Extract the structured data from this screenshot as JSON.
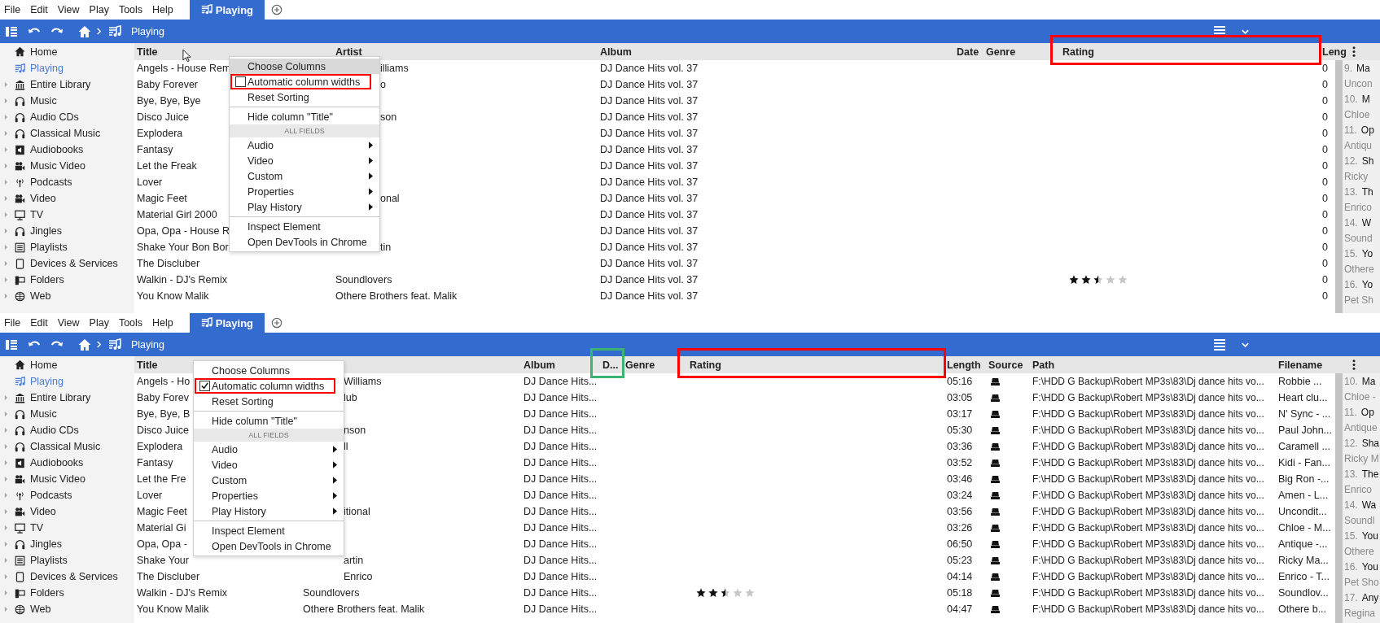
{
  "panels": [
    {
      "menu": [
        "File",
        "Edit",
        "View",
        "Play",
        "Tools",
        "Help"
      ],
      "tabs": [
        {
          "label": "Playing",
          "selected": true
        }
      ],
      "breadcrumb": "Playing",
      "mouse_cursor": true,
      "sidebar": [
        {
          "label": "Home",
          "selected": false,
          "expandable": false
        },
        {
          "label": "Playing",
          "selected": true,
          "expandable": false
        },
        {
          "label": "Entire Library",
          "selected": false,
          "expandable": true
        },
        {
          "label": "Music",
          "selected": false,
          "expandable": true
        },
        {
          "label": "Audio CDs",
          "selected": false,
          "expandable": true
        },
        {
          "label": "Classical Music",
          "selected": false,
          "expandable": true
        },
        {
          "label": "Audiobooks",
          "selected": false,
          "expandable": true
        },
        {
          "label": "Music Video",
          "selected": false,
          "expandable": true
        },
        {
          "label": "Podcasts",
          "selected": false,
          "expandable": true
        },
        {
          "label": "Video",
          "selected": false,
          "expandable": true
        },
        {
          "label": "TV",
          "selected": false,
          "expandable": true
        },
        {
          "label": "Jingles",
          "selected": false,
          "expandable": true
        },
        {
          "label": "Playlists",
          "selected": false,
          "expandable": true
        },
        {
          "label": "Devices & Services",
          "selected": false,
          "expandable": true
        },
        {
          "label": "Folders",
          "selected": false,
          "expandable": true
        },
        {
          "label": "Web",
          "selected": false,
          "expandable": true
        }
      ],
      "columns": [
        {
          "label": "Title",
          "kind": "title"
        },
        {
          "label": "Artist",
          "kind": "artist"
        },
        {
          "label": "Album",
          "kind": "album"
        },
        {
          "label": "Date",
          "kind": "date"
        },
        {
          "label": "Genre",
          "kind": "genre"
        },
        {
          "label": "Rating",
          "kind": "rating",
          "color": "#ff0000"
        },
        {
          "label": "Leng",
          "kind": "length"
        }
      ],
      "rows": [
        {
          "title": "Angels - House Rem",
          "artist": "illiams",
          "album": "DJ Dance Hits vol. 37",
          "length": "0"
        },
        {
          "title": "Baby Forever",
          "artist": "o",
          "album": "DJ Dance Hits vol. 37",
          "length": "0"
        },
        {
          "title": "Bye, Bye, Bye",
          "album": "DJ Dance Hits vol. 37",
          "length": "0"
        },
        {
          "title": "Disco Juice",
          "artist": "son",
          "album": "DJ Dance Hits vol. 37",
          "length": "0"
        },
        {
          "title": "Explodera",
          "album": "DJ Dance Hits vol. 37",
          "length": "0"
        },
        {
          "title": "Fantasy",
          "album": "DJ Dance Hits vol. 37",
          "length": "0"
        },
        {
          "title": "Let the Freak",
          "album": "DJ Dance Hits vol. 37",
          "length": "0"
        },
        {
          "title": "Lover",
          "album": "DJ Dance Hits vol. 37",
          "length": "0"
        },
        {
          "title": "Magic Feet",
          "artist": "onal",
          "album": "DJ Dance Hits vol. 37",
          "length": "0"
        },
        {
          "title": "Material Girl 2000",
          "album": "DJ Dance Hits vol. 37",
          "length": "0"
        },
        {
          "title": "Opa, Opa - House R",
          "album": "DJ Dance Hits vol. 37",
          "length": "0"
        },
        {
          "title": "Shake Your Bon Bor",
          "artist": "tin",
          "album": "DJ Dance Hits vol. 37",
          "length": "0"
        },
        {
          "title": "The Discluber",
          "album": "DJ Dance Hits vol. 37",
          "length": "0"
        },
        {
          "title": "Walkin - DJ's Remix",
          "artist": "Soundlovers",
          "album": "DJ Dance Hits vol. 37",
          "stars": 2.5,
          "length": "0"
        },
        {
          "title": "You Know Malik",
          "artist": "Othere Brothers feat. Malik",
          "album": "DJ Dance Hits vol. 37",
          "length": "0"
        }
      ],
      "context_menu": {
        "items": [
          {
            "kind": "item",
            "label": "Choose Columns",
            "selected": true
          },
          {
            "kind": "check",
            "label": "Automatic column widths",
            "checked": false,
            "selected": false,
            "color": "#ff0000"
          },
          {
            "kind": "item",
            "label": "Reset Sorting",
            "selected": false
          },
          {
            "kind": "separator"
          },
          {
            "kind": "item",
            "label": "Hide column \"Title\"",
            "selected": false
          },
          {
            "kind": "section",
            "label": "ALL FIELDS"
          },
          {
            "kind": "submenu",
            "label": "Audio",
            "selected": false
          },
          {
            "kind": "submenu",
            "label": "Video",
            "selected": false
          },
          {
            "kind": "submenu",
            "label": "Custom",
            "selected": false
          },
          {
            "kind": "submenu",
            "label": "Properties",
            "selected": false
          },
          {
            "kind": "submenu",
            "label": "Play History",
            "selected": false
          },
          {
            "kind": "separator"
          },
          {
            "kind": "item",
            "label": "Inspect Element",
            "selected": false
          },
          {
            "kind": "item",
            "label": "Open DevTools in Chrome",
            "selected": false
          }
        ]
      },
      "now_playing": [
        {
          "number": "9.",
          "title": "Ma",
          "artist": "Uncon"
        },
        {
          "number": "10.",
          "title": "M",
          "artist": "Chloe"
        },
        {
          "number": "11.",
          "title": "Op",
          "artist": "Antiqu"
        },
        {
          "number": "12.",
          "title": "Sh",
          "artist": "Ricky"
        },
        {
          "number": "13.",
          "title": "Th",
          "artist": "Enrico"
        },
        {
          "number": "14.",
          "title": "W",
          "artist": "Sound"
        },
        {
          "number": "15.",
          "title": "Yo",
          "artist": "Othere"
        },
        {
          "number": "16.",
          "title": "Yo",
          "artist": "Pet Sh"
        }
      ]
    },
    {
      "menu": [
        "File",
        "Edit",
        "View",
        "Play",
        "Tools",
        "Help"
      ],
      "tabs": [
        {
          "label": "Playing",
          "selected": true
        }
      ],
      "breadcrumb": "Playing",
      "sidebar": [
        {
          "label": "Home",
          "selected": false,
          "expandable": false
        },
        {
          "label": "Playing",
          "selected": true,
          "expandable": false
        },
        {
          "label": "Entire Library",
          "selected": false,
          "expandable": true
        },
        {
          "label": "Music",
          "selected": false,
          "expandable": true
        },
        {
          "label": "Audio CDs",
          "selected": false,
          "expandable": true
        },
        {
          "label": "Classical Music",
          "selected": false,
          "expandable": true
        },
        {
          "label": "Audiobooks",
          "selected": false,
          "expandable": true
        },
        {
          "label": "Music Video",
          "selected": false,
          "expandable": true
        },
        {
          "label": "Podcasts",
          "selected": false,
          "expandable": true
        },
        {
          "label": "Video",
          "selected": false,
          "expandable": true
        },
        {
          "label": "TV",
          "selected": false,
          "expandable": true
        },
        {
          "label": "Jingles",
          "selected": false,
          "expandable": true
        },
        {
          "label": "Playlists",
          "selected": false,
          "expandable": true
        },
        {
          "label": "Devices & Services",
          "selected": false,
          "expandable": true
        },
        {
          "label": "Folders",
          "selected": false,
          "expandable": true
        },
        {
          "label": "Web",
          "selected": false,
          "expandable": true
        }
      ],
      "columns": [
        {
          "label": "Title",
          "kind": "title"
        },
        {
          "kind": "artist"
        },
        {
          "label": "Album",
          "kind": "album"
        },
        {
          "label": "D...",
          "kind": "date",
          "color": "#3cb371"
        },
        {
          "label": "Genre",
          "kind": "genre"
        },
        {
          "label": "Rating",
          "kind": "rating",
          "color": "#ff0000"
        },
        {
          "label": "Length",
          "kind": "length"
        },
        {
          "label": "Source",
          "kind": "source"
        },
        {
          "label": "Path",
          "kind": "path"
        },
        {
          "label": "Filename",
          "kind": "filename"
        }
      ],
      "rows": [
        {
          "title": "Angels - Ho",
          "artist": "Williams",
          "album": "DJ Dance Hits...",
          "length": "05:16",
          "path": "F:\\HDD G Backup\\Robert MP3s\\83\\Dj dance hits vo...",
          "filename": "Robbie ..."
        },
        {
          "title": "Baby Forev",
          "artist": "lub",
          "album": "DJ Dance Hits...",
          "length": "03:05",
          "path": "F:\\HDD G Backup\\Robert MP3s\\83\\Dj dance hits vo...",
          "filename": "Heart clu..."
        },
        {
          "title": "Bye, Bye, B",
          "album": "DJ Dance Hits...",
          "length": "03:17",
          "path": "F:\\HDD G Backup\\Robert MP3s\\83\\Dj dance hits vo...",
          "filename": "N' Sync - ..."
        },
        {
          "title": "Disco Juice",
          "artist": "nson",
          "album": "DJ Dance Hits...",
          "length": "05:30",
          "path": "F:\\HDD G Backup\\Robert MP3s\\83\\Dj dance hits vo...",
          "filename": "Paul John..."
        },
        {
          "title": "Explodera",
          "artist": "ll",
          "album": "DJ Dance Hits...",
          "length": "03:36",
          "path": "F:\\HDD G Backup\\Robert MP3s\\83\\Dj dance hits vo...",
          "filename": "Caramell ..."
        },
        {
          "title": "Fantasy",
          "album": "DJ Dance Hits...",
          "length": "03:52",
          "path": "F:\\HDD G Backup\\Robert MP3s\\83\\Dj dance hits vo...",
          "filename": "Kidi - Fan..."
        },
        {
          "title": "Let the Fre",
          "album": "DJ Dance Hits...",
          "length": "03:46",
          "path": "F:\\HDD G Backup\\Robert MP3s\\83\\Dj dance hits vo...",
          "filename": "Big Ron -..."
        },
        {
          "title": "Lover",
          "album": "DJ Dance Hits...",
          "length": "03:24",
          "path": "F:\\HDD G Backup\\Robert MP3s\\83\\Dj dance hits vo...",
          "filename": "Amen - L..."
        },
        {
          "title": "Magic Feet",
          "artist": "itional",
          "album": "DJ Dance Hits...",
          "length": "03:56",
          "path": "F:\\HDD G Backup\\Robert MP3s\\83\\Dj dance hits vo...",
          "filename": "Uncondit..."
        },
        {
          "title": "Material Gi",
          "album": "DJ Dance Hits...",
          "length": "03:26",
          "path": "F:\\HDD G Backup\\Robert MP3s\\83\\Dj dance hits vo...",
          "filename": "Chloe - M..."
        },
        {
          "title": "Opa, Opa -",
          "album": "DJ Dance Hits...",
          "length": "06:50",
          "path": "F:\\HDD G Backup\\Robert MP3s\\83\\Dj dance hits vo...",
          "filename": "Antique -..."
        },
        {
          "title": "Shake Your",
          "artist": "artin",
          "album": "DJ Dance Hits...",
          "length": "05:23",
          "path": "F:\\HDD G Backup\\Robert MP3s\\83\\Dj dance hits vo...",
          "filename": "Ricky Ma..."
        },
        {
          "title": "The Discluber",
          "artist": "Enrico",
          "album": "DJ Dance Hits...",
          "length": "04:14",
          "path": "F:\\HDD G Backup\\Robert MP3s\\83\\Dj dance hits vo...",
          "filename": "Enrico - T..."
        },
        {
          "title": "Walkin - DJ's Remix",
          "artist": "Soundlovers",
          "album": "DJ Dance Hits...",
          "stars": 2.5,
          "length": "05:18",
          "path": "F:\\HDD G Backup\\Robert MP3s\\83\\Dj dance hits vo...",
          "filename": "Soundlov..."
        },
        {
          "title": "You Know Malik",
          "artist": "Othere Brothers feat. Malik",
          "album": "DJ Dance Hits...",
          "length": "04:47",
          "path": "F:\\HDD G Backup\\Robert MP3s\\83\\Dj dance hits vo...",
          "filename": "Othere b..."
        }
      ],
      "context_menu": {
        "items": [
          {
            "kind": "item",
            "label": "Choose Columns",
            "selected": false
          },
          {
            "kind": "check",
            "label": "Automatic column widths",
            "checked": true,
            "selected": false,
            "color": "#ff0000"
          },
          {
            "kind": "item",
            "label": "Reset Sorting",
            "selected": false
          },
          {
            "kind": "separator"
          },
          {
            "kind": "item",
            "label": "Hide column \"Title\"",
            "selected": false
          },
          {
            "kind": "section",
            "label": "ALL FIELDS"
          },
          {
            "kind": "submenu",
            "label": "Audio",
            "selected": false
          },
          {
            "kind": "submenu",
            "label": "Video",
            "selected": false
          },
          {
            "kind": "submenu",
            "label": "Custom",
            "selected": false
          },
          {
            "kind": "submenu",
            "label": "Properties",
            "selected": false
          },
          {
            "kind": "submenu",
            "label": "Play History",
            "selected": false
          },
          {
            "kind": "separator"
          },
          {
            "kind": "item",
            "label": "Inspect Element",
            "selected": false
          },
          {
            "kind": "item",
            "label": "Open DevTools in Chrome",
            "selected": false
          }
        ]
      },
      "now_playing": [
        {
          "number": "10.",
          "title": "Ma",
          "artist": "Chloe -"
        },
        {
          "number": "11.",
          "title": "Op",
          "artist": "Antique"
        },
        {
          "number": "12.",
          "title": "Sha",
          "artist": "Ricky M"
        },
        {
          "number": "13.",
          "title": "The",
          "artist": "Enrico"
        },
        {
          "number": "14.",
          "title": "Wa",
          "artist": "Soundl"
        },
        {
          "number": "15.",
          "title": "You",
          "artist": "Othere"
        },
        {
          "number": "16.",
          "title": "You",
          "artist": "Pet Sho"
        },
        {
          "number": "17.",
          "title": "Any",
          "artist": "Regina"
        }
      ]
    }
  ]
}
